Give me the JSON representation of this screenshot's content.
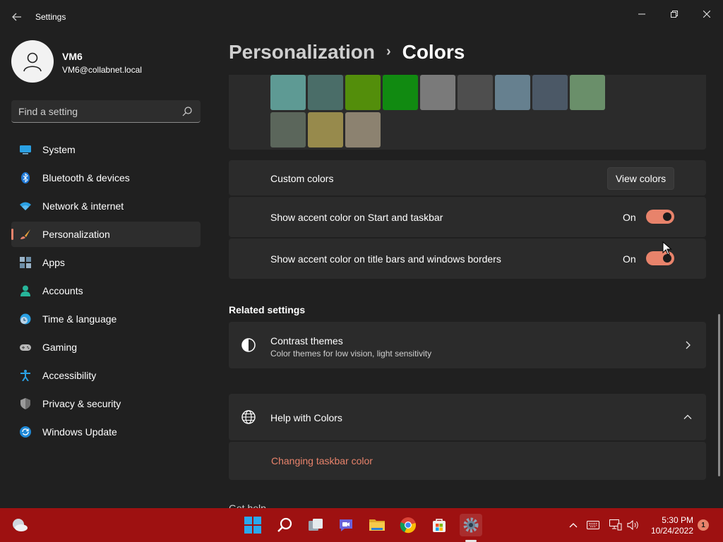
{
  "app": {
    "title": "Settings"
  },
  "profile": {
    "name": "VM6",
    "email": "VM6@collabnet.local"
  },
  "search": {
    "placeholder": "Find a setting"
  },
  "sidebar": {
    "items": [
      {
        "label": "System",
        "icon": "monitor-icon"
      },
      {
        "label": "Bluetooth & devices",
        "icon": "bluetooth-icon"
      },
      {
        "label": "Network & internet",
        "icon": "wifi-icon"
      },
      {
        "label": "Personalization",
        "icon": "brush-icon",
        "active": true
      },
      {
        "label": "Apps",
        "icon": "apps-icon"
      },
      {
        "label": "Accounts",
        "icon": "person-icon"
      },
      {
        "label": "Time & language",
        "icon": "globe-clock-icon"
      },
      {
        "label": "Gaming",
        "icon": "gamepad-icon"
      },
      {
        "label": "Accessibility",
        "icon": "accessibility-icon"
      },
      {
        "label": "Privacy & security",
        "icon": "shield-icon"
      },
      {
        "label": "Windows Update",
        "icon": "update-icon"
      }
    ]
  },
  "breadcrumb": {
    "parent": "Personalization",
    "separator": "›",
    "current": "Colors"
  },
  "colors": {
    "accent_swatches_row1": [
      "#5e9a94",
      "#4a6d68",
      "#538e0b",
      "#118a11",
      "#7a7a7a",
      "#4e4e4e",
      "#66808f",
      "#4b5866",
      "#6a8f6a"
    ],
    "accent_swatches_row2": [
      "#5b665b",
      "#978a4c",
      "#8c8270"
    ],
    "accent": "#e8836b",
    "taskbar": "#9e1111"
  },
  "custom_colors": {
    "label": "Custom colors",
    "button": "View colors"
  },
  "toggles": [
    {
      "label": "Show accent color on Start and taskbar",
      "state": "On"
    },
    {
      "label": "Show accent color on title bars and windows borders",
      "state": "On"
    }
  ],
  "related": {
    "title": "Related settings",
    "contrast": {
      "title": "Contrast themes",
      "subtitle": "Color themes for low vision, light sensitivity"
    }
  },
  "help": {
    "title": "Help with Colors",
    "link": "Changing taskbar color"
  },
  "peek_text": "Get help",
  "taskbar": {
    "icons": [
      "start-icon",
      "search-icon",
      "task-view-icon",
      "teams-chat-icon",
      "file-explorer-icon",
      "chrome-icon",
      "store-icon",
      "settings-icon"
    ],
    "time": "5:30 PM",
    "date": "10/24/2022",
    "notifications": "1"
  }
}
